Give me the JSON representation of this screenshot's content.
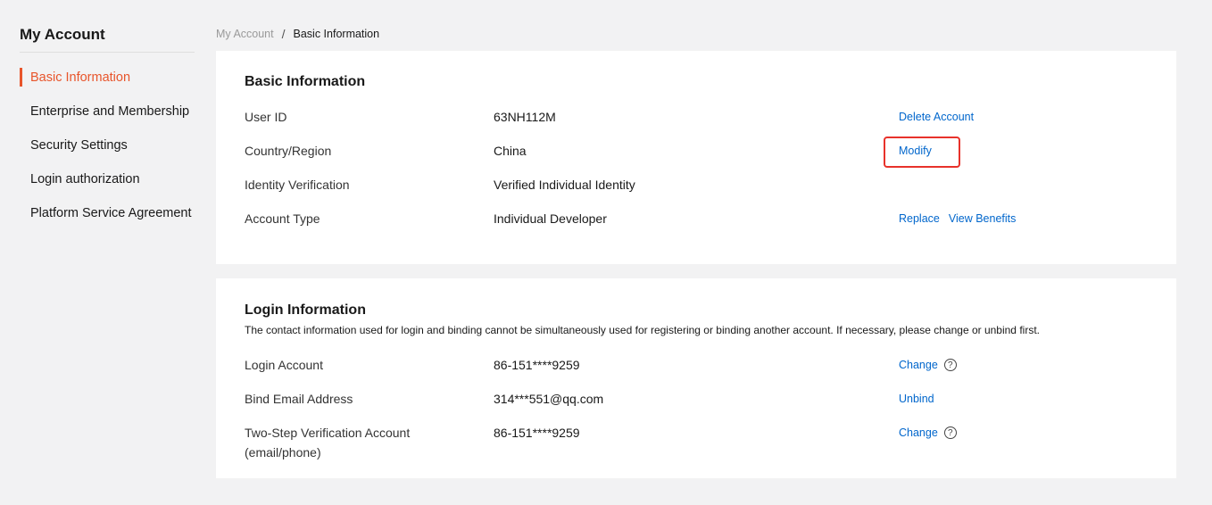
{
  "sidebar": {
    "title": "My Account",
    "items": [
      {
        "label": "Basic Information"
      },
      {
        "label": "Enterprise and Membership"
      },
      {
        "label": "Security Settings"
      },
      {
        "label": "Login authorization"
      },
      {
        "label": "Platform Service Agreement"
      }
    ]
  },
  "breadcrumb": {
    "home": "My Account",
    "separator": "/",
    "current": "Basic Information"
  },
  "basic": {
    "title": "Basic Information",
    "rows": [
      {
        "label": "User ID",
        "value": "63NH112M",
        "actions": [
          "Delete Account"
        ]
      },
      {
        "label": "Country/Region",
        "value": "China",
        "actions": [
          "Modify"
        ]
      },
      {
        "label": "Identity Verification",
        "value": "Verified Individual Identity",
        "actions": []
      },
      {
        "label": "Account Type",
        "value": "Individual Developer",
        "actions": [
          "Replace",
          "View Benefits"
        ]
      }
    ]
  },
  "login": {
    "title": "Login Information",
    "description": "The contact information used for login and binding cannot be simultaneously used for registering or binding another account. If necessary, please change or unbind first.",
    "rows": [
      {
        "label": "Login Account",
        "value": "86-151****9259",
        "actions": [
          "Change"
        ],
        "help": "?"
      },
      {
        "label": "Bind Email Address",
        "value": "314***551@qq.com",
        "actions": [
          "Unbind"
        ]
      },
      {
        "label": "Two-Step Verification Account",
        "label2": "(email/phone)",
        "value": "86-151****9259",
        "actions": [
          "Change"
        ],
        "help": "?"
      }
    ]
  },
  "colors": {
    "accent": "#e8552b",
    "link": "#0066cc",
    "highlight": "#e8322b",
    "background": "#f2f2f3"
  }
}
